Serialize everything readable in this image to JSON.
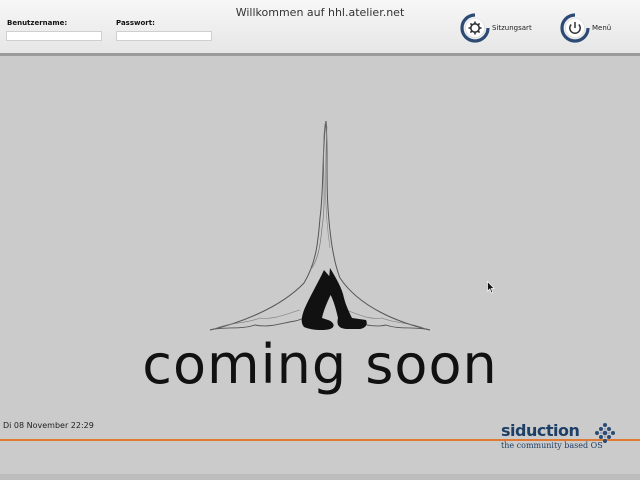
{
  "header": {
    "welcome": "Willkommen auf hhl.atelier.net"
  },
  "login": {
    "username_label": "Benutzername:",
    "username_value": "",
    "password_label": "Passwort:",
    "password_value": ""
  },
  "buttons": {
    "session": {
      "label": "Sitzungsart",
      "icon": "gear-icon"
    },
    "menu": {
      "label": "Menü",
      "icon": "power-icon"
    }
  },
  "main": {
    "tagline": "coming soon"
  },
  "footer": {
    "datetime": "Di 08 November 22:29",
    "logo_text": "siduction",
    "logo_tagline": "the community based OS"
  },
  "colors": {
    "accent_blue": "#1e3f66",
    "accent_orange": "#e07a32",
    "background": "#cbcbcb"
  }
}
